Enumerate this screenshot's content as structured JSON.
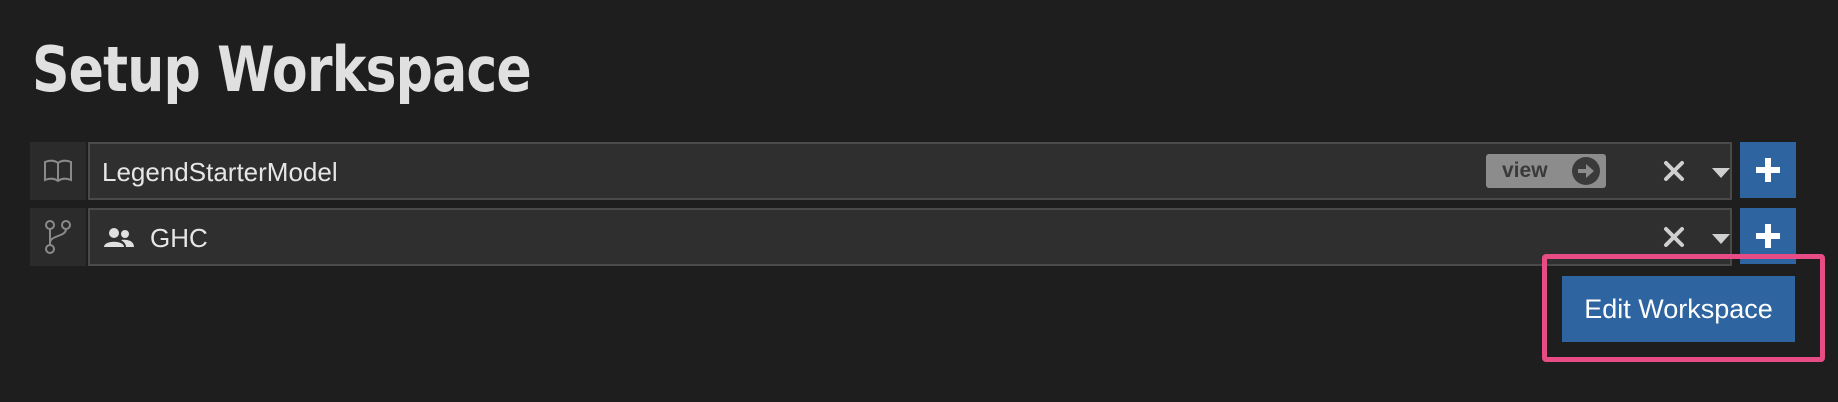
{
  "page": {
    "title": "Setup Workspace"
  },
  "project_row": {
    "icon": "book-open-icon",
    "value": "LegendStarterModel",
    "view_label": "view",
    "view_icon": "arrow-right-circle-icon",
    "clear_icon": "close-icon",
    "dropdown_icon": "caret-down-icon",
    "add_icon": "plus-icon"
  },
  "workspace_row": {
    "icon": "git-branch-icon",
    "value_icon": "group-users-icon",
    "value": "GHC",
    "clear_icon": "close-icon",
    "dropdown_icon": "caret-down-icon",
    "add_icon": "plus-icon"
  },
  "actions": {
    "edit_workspace_label": "Edit Workspace"
  },
  "colors": {
    "background": "#1e1e1e",
    "accent": "#2e64a0",
    "highlight": "#e84c84"
  }
}
